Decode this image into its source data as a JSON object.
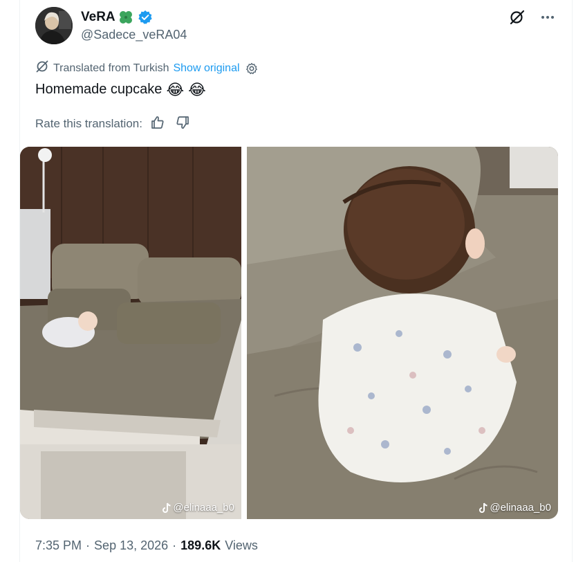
{
  "author": {
    "display_name": "VeRA",
    "handle": "@Sadece_veRA04"
  },
  "icons": {
    "clover": "four-leaf-clover-icon",
    "verified": "verified-badge-icon",
    "grok": "grok-icon",
    "more": "more-options-icon",
    "translate": "translate-icon",
    "settings": "gear-icon",
    "thumbs_up": "thumbs-up-icon",
    "thumbs_down": "thumbs-down-icon",
    "tiktok": "tiktok-icon"
  },
  "translation": {
    "label": "Translated from Turkish",
    "show_original": "Show original"
  },
  "tweet": {
    "text": "Homemade cupcake",
    "emojis": [
      "😂",
      "😂"
    ]
  },
  "rating": {
    "label": "Rate this translation:"
  },
  "media": [
    {
      "watermark": "@elinaaa_b0"
    },
    {
      "watermark": "@elinaaa_b0"
    }
  ],
  "meta": {
    "time": "7:35 PM",
    "separator": "·",
    "date": "Sep 13, 2026",
    "views_count": "189.6K",
    "views_label": "Views"
  },
  "colors": {
    "accent": "#1d9bf0",
    "secondary_text": "#536471",
    "primary_text": "#0f1419",
    "clover": "#3ba55d"
  }
}
